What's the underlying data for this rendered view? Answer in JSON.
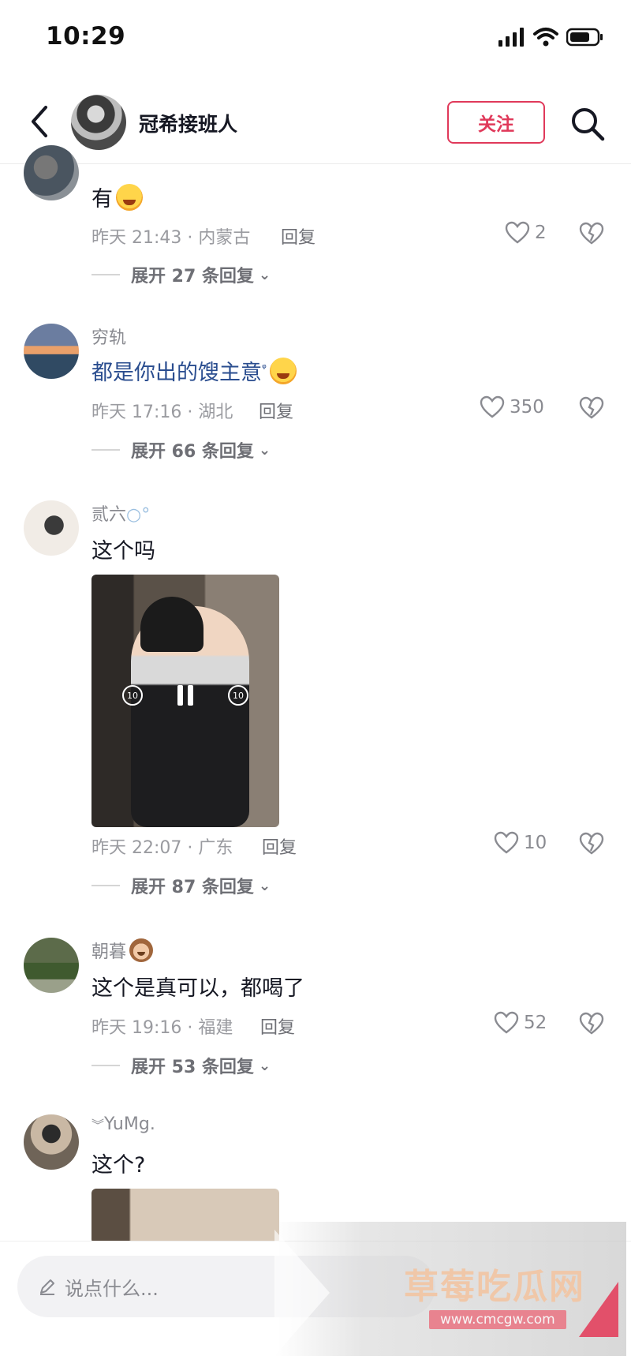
{
  "status_bar": {
    "time": "10:29"
  },
  "header": {
    "username": "冠希接班人",
    "follow_label": "关注"
  },
  "comments": [
    {
      "username": "",
      "text": "有",
      "time_location": "昨天 21:43 · 内蒙古",
      "reply_label": "回复",
      "likes": "2",
      "expand_label": "展开 27 条回复"
    },
    {
      "username": "穷轨",
      "text": "都是你出的馊主意",
      "time_location": "昨天 17:16 · 湖北",
      "reply_label": "回复",
      "likes": "350",
      "expand_label": "展开 66 条回复"
    },
    {
      "username": "贰六",
      "text": "这个吗",
      "time_location": "昨天 22:07 · 广东",
      "reply_label": "回复",
      "likes": "10",
      "expand_label": "展开 87 条回复",
      "video_controls": {
        "rewind": "10",
        "forward": "10"
      }
    },
    {
      "username": "朝暮",
      "text": "这个是真可以，都喝了",
      "time_location": "昨天 19:16 · 福建",
      "reply_label": "回复",
      "likes": "52",
      "expand_label": "展开 53 条回复"
    },
    {
      "username": "YuMg.",
      "text": "这个?"
    }
  ],
  "bottom_bar": {
    "input_placeholder": "说点什么..."
  },
  "watermark": {
    "title": "草莓吃瓜网",
    "url": "www.cmcgw.com"
  },
  "colors": {
    "accent": "#e0395a",
    "link_text": "#2a4d8f",
    "meta_text": "#9a9ba0"
  }
}
